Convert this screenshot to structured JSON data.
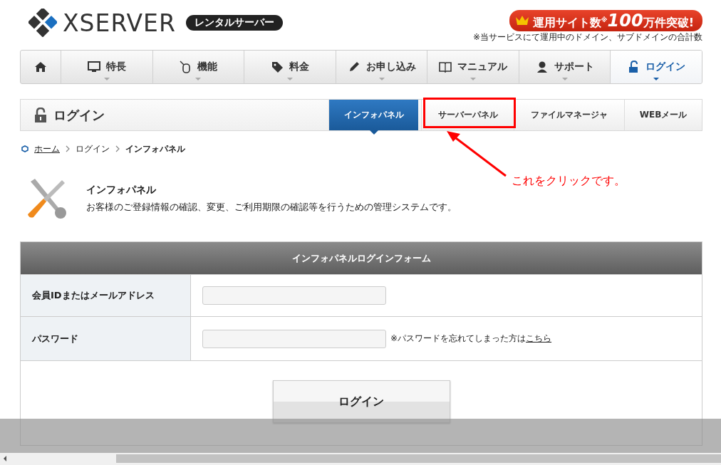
{
  "logo": {
    "name": "XSERVER",
    "badge": "レンタルサーバー"
  },
  "promo": {
    "headline": "運用サイト数$^{※}$**100**万件突破!",
    "note": "※当サービスにて運用中のドメイン、サブドメインの合計数"
  },
  "nav": [
    {
      "kind": "home",
      "selected": false
    },
    {
      "kind": "monitor",
      "label": "特長",
      "selected": false
    },
    {
      "kind": "mouse",
      "label": "機能",
      "selected": false
    },
    {
      "kind": "tag",
      "label": "料金",
      "selected": false
    },
    {
      "kind": "pencil",
      "label": "お申し込み",
      "selected": false
    },
    {
      "kind": "book",
      "label": "マニュアル",
      "selected": false
    },
    {
      "kind": "person",
      "label": "サポート",
      "selected": false
    },
    {
      "kind": "lock",
      "label": "ログイン",
      "selected": true
    }
  ],
  "subnav": {
    "title": "ログイン",
    "tabs": [
      {
        "label": "インフォパネル",
        "selected": true,
        "highlighted": false
      },
      {
        "label": "サーバーパネル",
        "selected": false,
        "highlighted": true
      },
      {
        "label": "ファイルマネージャ",
        "selected": false,
        "highlighted": false
      },
      {
        "label": "WEBメール",
        "selected": false,
        "highlighted": false
      }
    ]
  },
  "annotation": {
    "text": "これをクリックです。"
  },
  "breadcrumb": [
    {
      "kind": "link",
      "label": "ホーム"
    },
    {
      "kind": "text",
      "label": "ログイン"
    },
    {
      "kind": "current",
      "label": "インフォパネル"
    }
  ],
  "intro": {
    "title": "インフォパネル",
    "description": "お客様のご登録情報の確認、変更、ご利用期限の確認等を行うための管理システムです。"
  },
  "form": {
    "title": "インフォパネルログインフォーム",
    "fields": [
      {
        "label": "会員IDまたはメールアドレス"
      },
      {
        "label": "パスワード",
        "note": "※パスワードを忘れてしまった方は",
        "link": "こちら"
      }
    ],
    "submit": "ログイン"
  }
}
